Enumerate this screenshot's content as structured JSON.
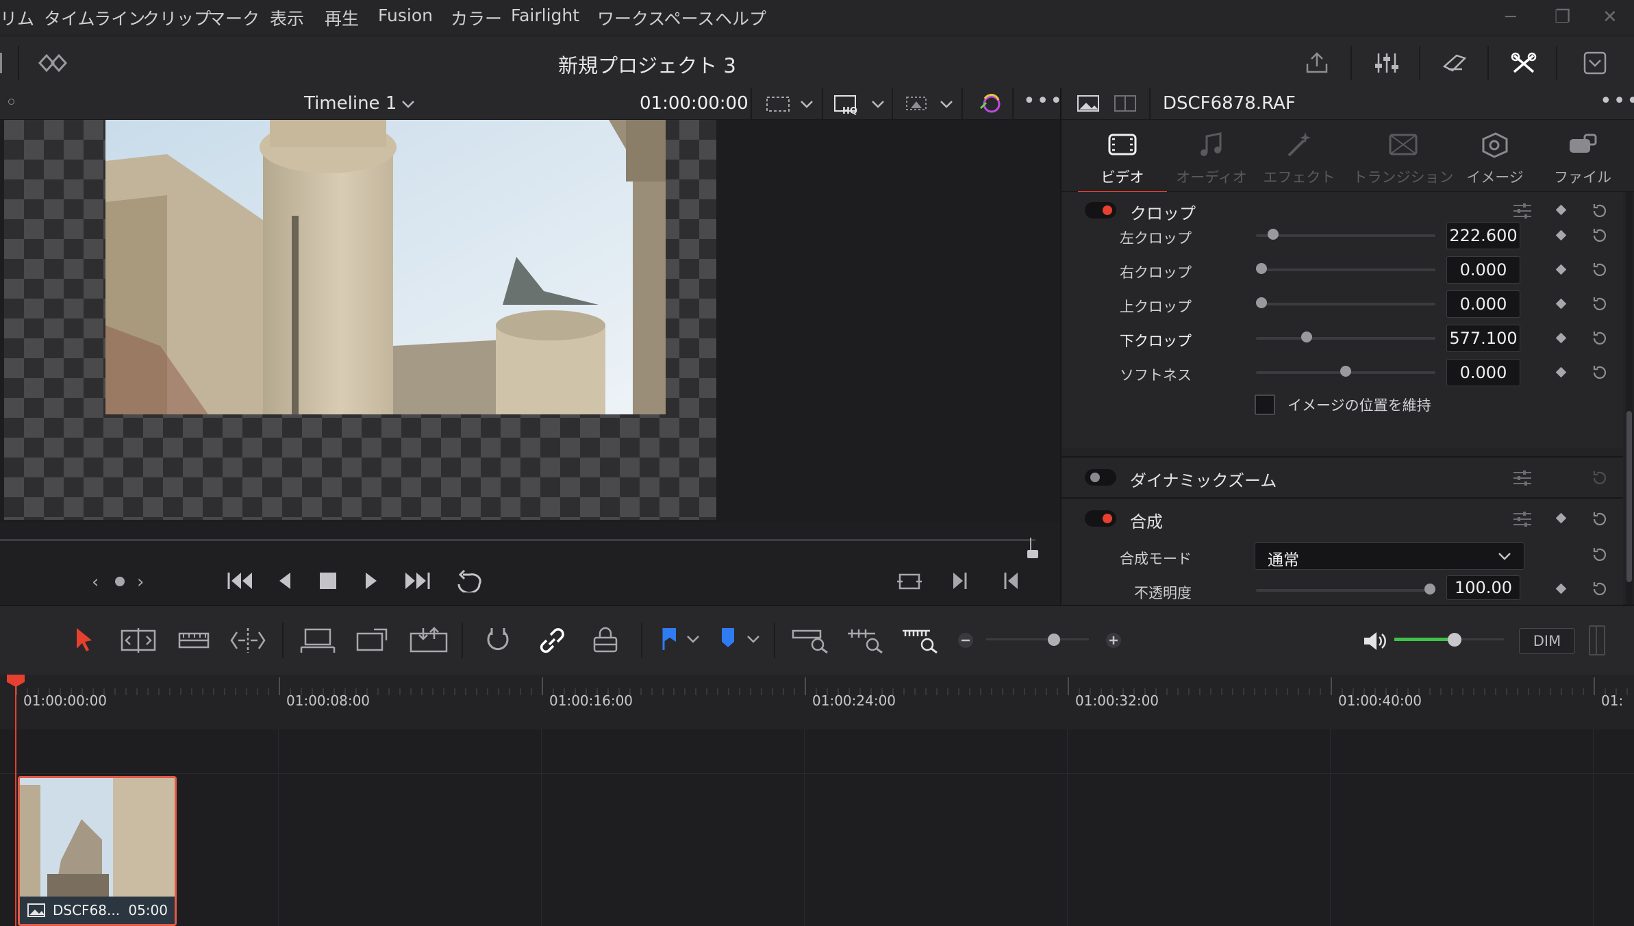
{
  "menubar": {
    "items": [
      "リム",
      "タイムライン",
      "クリップ",
      "マーク",
      "表示",
      "再生",
      "Fusion",
      "カラー",
      "Fairlight",
      "ワークスペース",
      "ヘルプ"
    ]
  },
  "titlebar": {
    "project_title": "新規プロジェクト 3"
  },
  "viewer": {
    "timeline_name": "Timeline 1",
    "timecode": "01:00:00:00"
  },
  "inspector": {
    "file_name": "DSCF6878.RAF",
    "tabs": [
      "ビデオ",
      "オーディオ",
      "エフェクト",
      "トランジション",
      "イメージ",
      "ファイル"
    ],
    "active_tab": "ビデオ",
    "crop": {
      "title": "クロップ",
      "rows": [
        {
          "label": "左クロップ",
          "value": "222.600",
          "level": 0.07
        },
        {
          "label": "右クロップ",
          "value": "0.000",
          "level": 0.0
        },
        {
          "label": "上クロップ",
          "value": "0.000",
          "level": 0.0
        },
        {
          "label": "下クロップ",
          "value": "577.100",
          "level": 0.27
        },
        {
          "label": "ソフトネス",
          "value": "0.000",
          "level": 0.5
        }
      ],
      "checkbox_label": "イメージの位置を維持"
    },
    "dynamic_zoom": {
      "title": "ダイナミックズーム"
    },
    "composite": {
      "title": "合成",
      "mode_label": "合成モード",
      "mode_value": "通常",
      "opacity_label": "不透明度",
      "opacity_value": "100.00",
      "opacity_level": 1.0
    },
    "accent_color": "#e8402f"
  },
  "toolbar": {
    "dim_label": "DIM",
    "flag_color": "#2f7bf0",
    "marker_color": "#2f7bf0",
    "volume_level": 0.55
  },
  "timeline": {
    "ruler_labels": [
      "01:00:00:00",
      "01:00:08:00",
      "01:00:16:00",
      "01:00:24:00",
      "01:00:32:00",
      "01:00:40:00",
      "01:"
    ],
    "clip": {
      "name": "DSCF68...",
      "duration": "05:00"
    }
  }
}
